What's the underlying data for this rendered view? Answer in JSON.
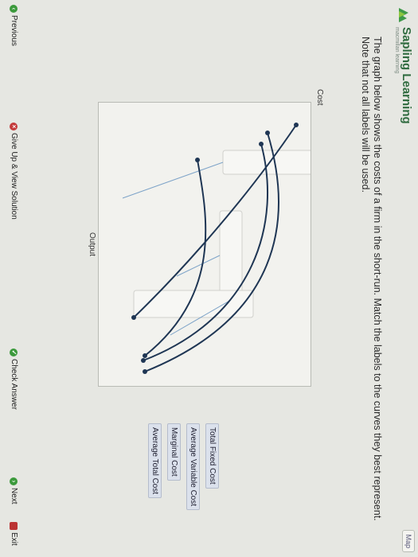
{
  "app": {
    "brand": "Sapling Learning",
    "brand_sub": "macmillan learning",
    "map_label": "Map"
  },
  "question": {
    "text": "The graph below shows the costs of a firm in the short-run. Match the labels to the curves they best represent. Note that not all labels will be used."
  },
  "graph": {
    "y_axis_label": "Cost",
    "x_axis_label": "Output",
    "curve_color": "#1f3654",
    "connector_color": "#7da3c8"
  },
  "labels": [
    "Total Fixed Cost",
    "Average Variable Cost",
    "Marginal Cost",
    "Average Total Cost"
  ],
  "nav": {
    "previous": "Previous",
    "give_up": "Give Up & View Solution",
    "check": "Check Answer",
    "next": "Next",
    "exit": "Exit"
  }
}
